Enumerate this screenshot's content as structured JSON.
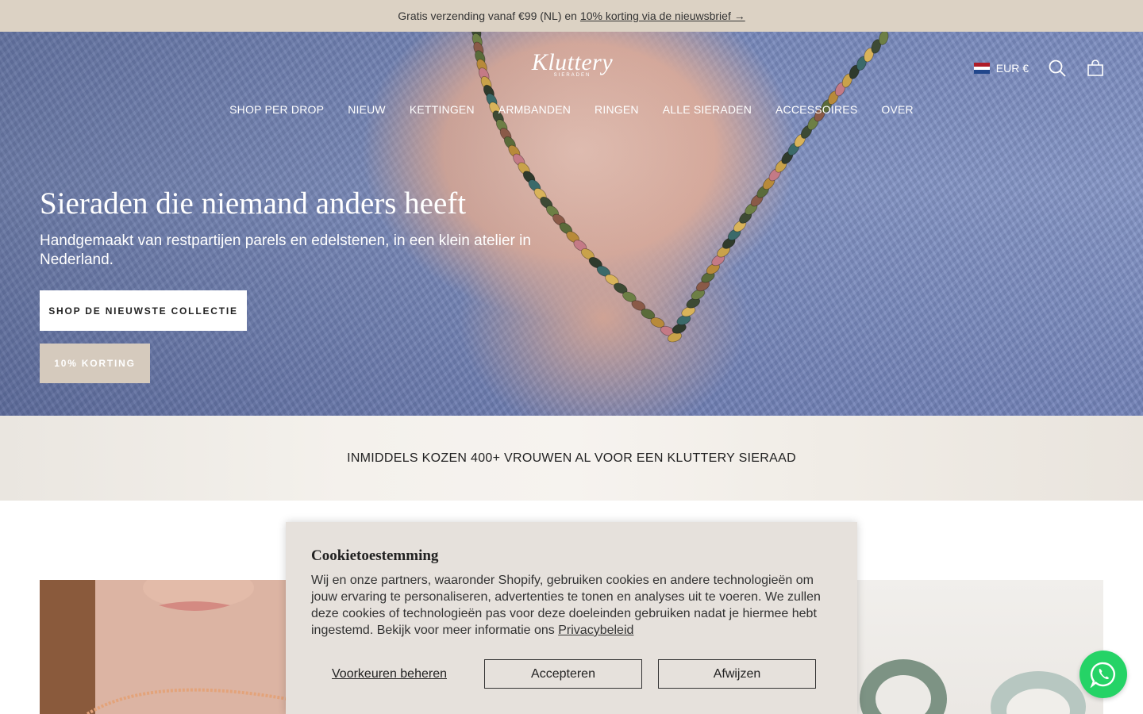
{
  "announcement": {
    "text": "Gratis verzending vanaf €99 (NL) en",
    "link": "10% korting via de nieuwsbrief →"
  },
  "header": {
    "logo": "Kluttery",
    "logo_sub": "SIERADEN",
    "currency": "EUR €",
    "icons": [
      "flag-nl-icon",
      "search-icon",
      "cart-icon"
    ]
  },
  "nav": {
    "items": [
      "SHOP PER DROP",
      "NIEUW",
      "KETTINGEN",
      "ARMBANDEN",
      "RINGEN",
      "ALLE SIERADEN",
      "ACCESSOIRES",
      "OVER"
    ]
  },
  "hero": {
    "title": "Sieraden die niemand anders heeft",
    "subtitle": "Handgemaakt van restpartijen parels en edelstenen, in een klein atelier in Nederland.",
    "primary_button": "SHOP DE NIEUWSTE COLLECTIE",
    "secondary_button": "10% KORTING"
  },
  "proof": {
    "text": "INMIDDELS KOZEN 400+ VROUWEN AL VOOR EEN KLUTTERY SIERAAD"
  },
  "cookie": {
    "title": "Cookietoestemming",
    "body": "Wij en onze partners, waaronder Shopify, gebruiken cookies en andere technologieën om jouw ervaring te personaliseren, advertenties te tonen en analyses uit te voeren. We zullen deze cookies of technologieën pas voor deze doeleinden gebruiken nadat je hiermee hebt ingestemd. Bekijk voor meer informatie ons",
    "policy_link": "Privacybeleid",
    "manage_label": "Voorkeuren beheren",
    "accept_label": "Accepteren",
    "decline_label": "Afwijzen"
  },
  "colors": {
    "announcement_bg": "#dcd2c4",
    "cookie_bg": "#e6e1dc",
    "accent_button": "#d5cabd",
    "whatsapp": "#25d366"
  }
}
